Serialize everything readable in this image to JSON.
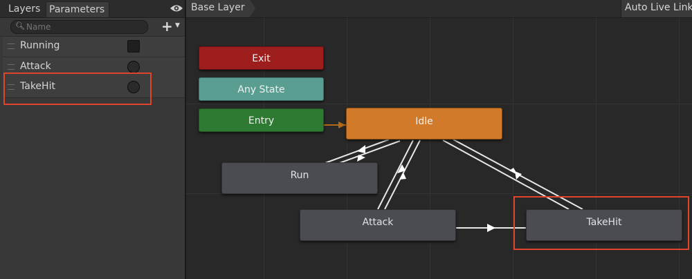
{
  "left_panel": {
    "tabs": {
      "layers": "Layers",
      "parameters": "Parameters"
    },
    "search": {
      "placeholder": "Name"
    },
    "parameters": [
      {
        "name": "Running",
        "type": "trigger"
      },
      {
        "name": "Attack",
        "type": "bool"
      },
      {
        "name": "TakeHit",
        "type": "bool"
      }
    ]
  },
  "graph": {
    "breadcrumb": "Base Layer",
    "auto_live_link": "Auto Live Link",
    "states": {
      "exit": "Exit",
      "any_state": "Any State",
      "entry": "Entry",
      "idle": "Idle",
      "run": "Run",
      "attack": "Attack",
      "takehit": "TakeHit"
    }
  },
  "colors": {
    "exit": "#9e1e1e",
    "any_state": "#5a9e92",
    "entry": "#2e7a32",
    "idle": "#d07a2a",
    "state": "#4a4c52",
    "highlight": "#e0442a"
  }
}
